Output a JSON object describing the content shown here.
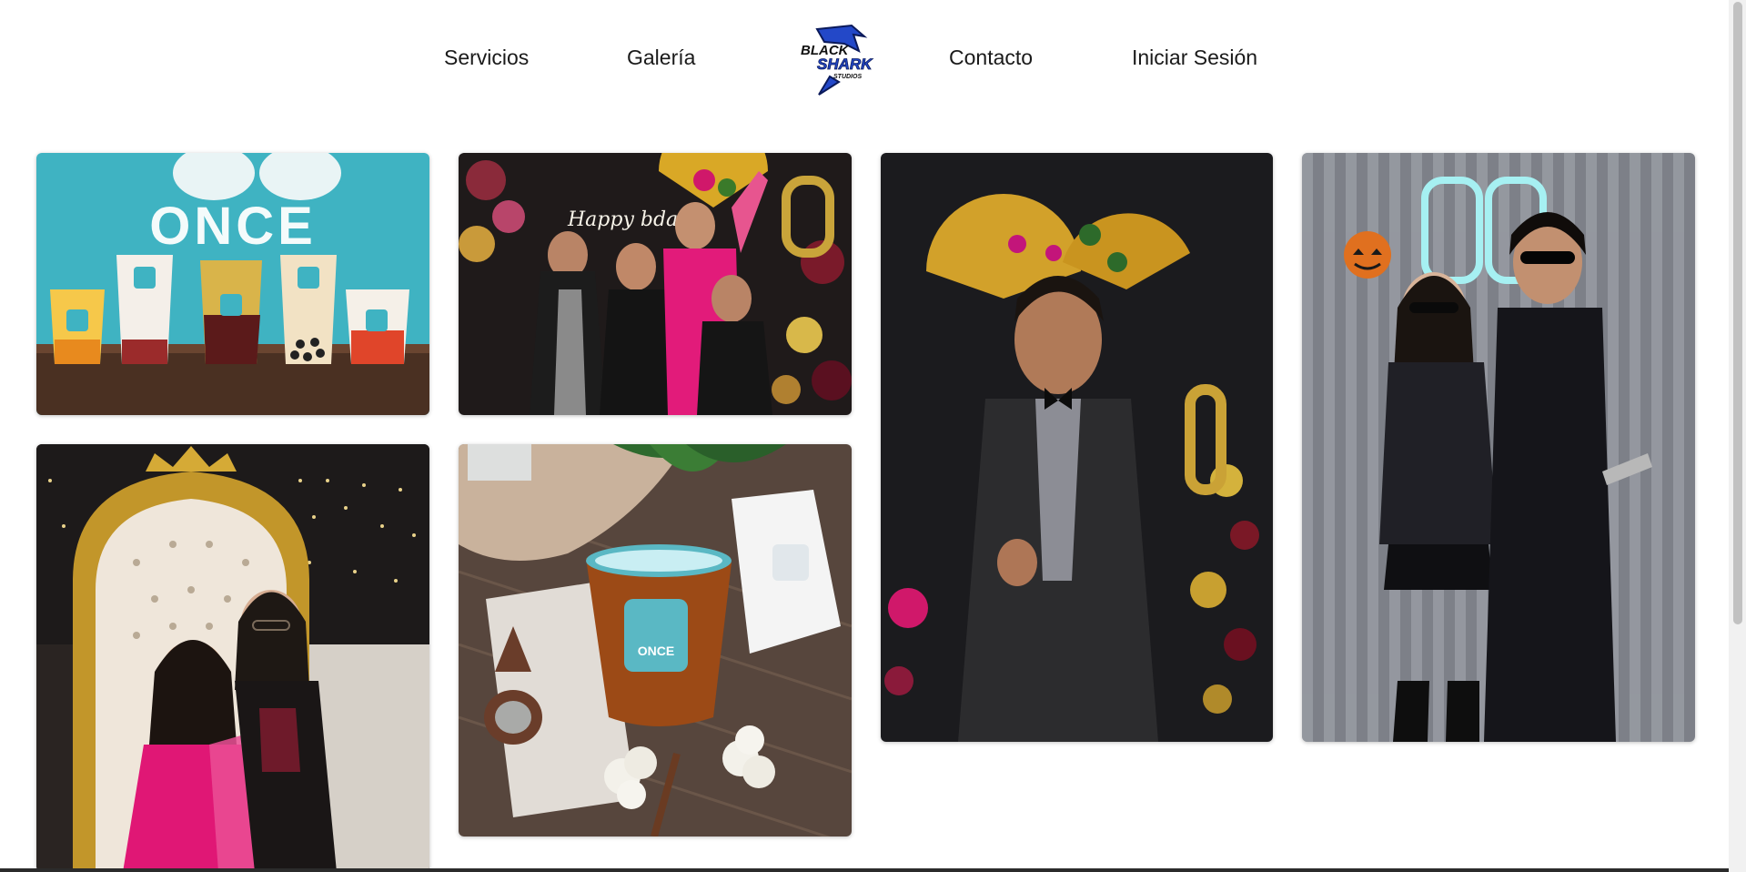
{
  "nav": {
    "items": [
      {
        "label": "Servicios"
      },
      {
        "label": "Galería"
      },
      {
        "label": "Contacto"
      },
      {
        "label": "Iniciar Sesión"
      }
    ],
    "logo": {
      "line1": "BLACK",
      "line2": "SHARK",
      "line3": "STUDIOS",
      "icon": "shark-logo-icon"
    }
  },
  "gallery": {
    "items": [
      {
        "subject": "drinks",
        "brand": "ONCE",
        "cup_brand": "ONCE"
      },
      {
        "subject": "party-group",
        "neon": "Happy bday"
      },
      {
        "subject": "man-in-suit"
      },
      {
        "subject": "couple-halloween"
      },
      {
        "subject": "mother-daughter-throne"
      },
      {
        "subject": "iced-tea",
        "cup_brand": "ONCE"
      }
    ]
  },
  "colors": {
    "text": "#1a1a1a",
    "logo_blue": "#2348c8",
    "once_teal": "#5ab8c4"
  }
}
